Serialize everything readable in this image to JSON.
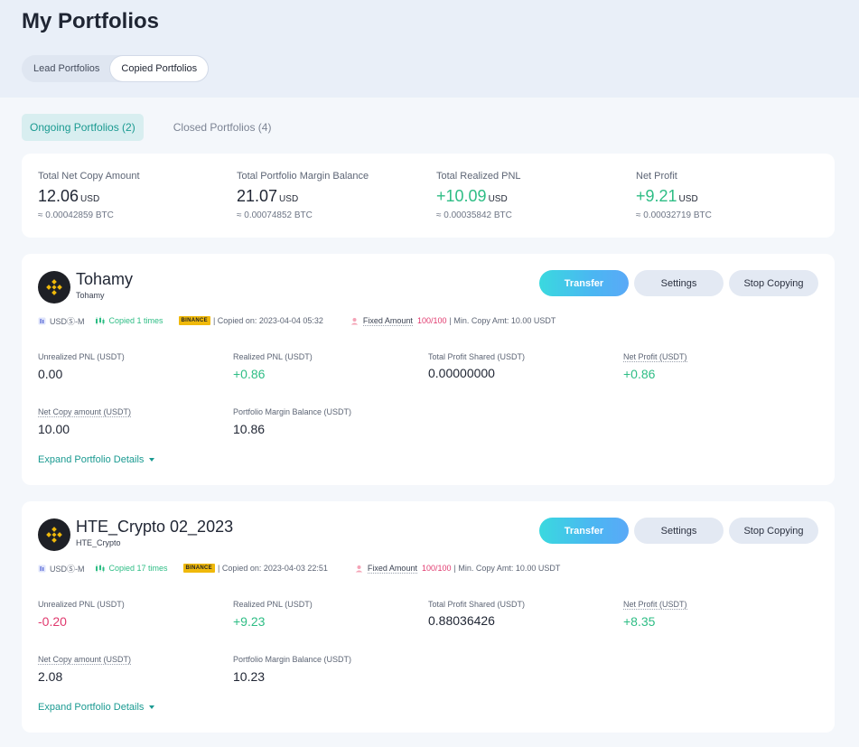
{
  "page": {
    "title": "My Portfolios"
  },
  "segment": {
    "lead": "Lead Portfolios",
    "copied": "Copied Portfolios"
  },
  "tabs": {
    "ongoing": "Ongoing Portfolios (2)",
    "closed": "Closed Portfolios (4)"
  },
  "summary": [
    {
      "label": "Total Net Copy Amount",
      "value": "12.06",
      "unit": "USD",
      "btc": "≈ 0.00042859 BTC"
    },
    {
      "label": "Total Portfolio Margin Balance",
      "value": "21.07",
      "unit": "USD",
      "btc": "≈ 0.00074852 BTC"
    },
    {
      "label": "Total Realized PNL",
      "value": "+10.09",
      "unit": "USD",
      "btc": "≈ 0.00035842 BTC"
    },
    {
      "label": "Net Profit",
      "value": "+9.21",
      "unit": "USD",
      "btc": "≈ 0.00032719 BTC"
    }
  ],
  "buttons": {
    "transfer": "Transfer",
    "settings": "Settings",
    "stop": "Stop Copying"
  },
  "portfolios": [
    {
      "name": "Tohamy",
      "user": "Tohamy",
      "meta": {
        "market": "USDⓈ-M",
        "copied_times": "Copied 1 times",
        "badge": "BINANCE",
        "copied_on": "| Copied on: 2023-04-04 05:32",
        "mode": "Fixed Amount",
        "slots": "100/100",
        "min": "| Min. Copy Amt: 10.00 USDT"
      },
      "stats": {
        "unrealized_label": "Unrealized PNL (USDT)",
        "unrealized": "0.00",
        "realized_label": "Realized PNL (USDT)",
        "realized": "+0.86",
        "profit_shared_label": "Total Profit Shared (USDT)",
        "profit_shared": "0.00000000",
        "net_profit_label": "Net Profit (USDT)",
        "net_profit": "+0.86",
        "net_copy_label": "Net Copy amount (USDT)",
        "net_copy": "10.00",
        "margin_label": "Portfolio Margin Balance (USDT)",
        "margin": "10.86"
      },
      "expand": "Expand Portfolio Details"
    },
    {
      "name": "HTE_Crypto 02_2023",
      "user": "HTE_Crypto",
      "meta": {
        "market": "USDⓈ-M",
        "copied_times": "Copied 17 times",
        "badge": "BINANCE",
        "copied_on": "| Copied on: 2023-04-03 22:51",
        "mode": "Fixed Amount",
        "slots": "100/100",
        "min": "| Min. Copy Amt: 10.00 USDT"
      },
      "stats": {
        "unrealized_label": "Unrealized PNL (USDT)",
        "unrealized": "-0.20",
        "realized_label": "Realized PNL (USDT)",
        "realized": "+9.23",
        "profit_shared_label": "Total Profit Shared (USDT)",
        "profit_shared": "0.88036426",
        "net_profit_label": "Net Profit (USDT)",
        "net_profit": "+8.35",
        "net_copy_label": "Net Copy amount (USDT)",
        "net_copy": "2.08",
        "margin_label": "Portfolio Margin Balance (USDT)",
        "margin": "10.23"
      },
      "expand": "Expand Portfolio Details"
    }
  ],
  "colors": {
    "accent": "#1a9a91",
    "positive": "#2ebd85",
    "negative": "#e0396e",
    "binance": "#f0b90b"
  }
}
